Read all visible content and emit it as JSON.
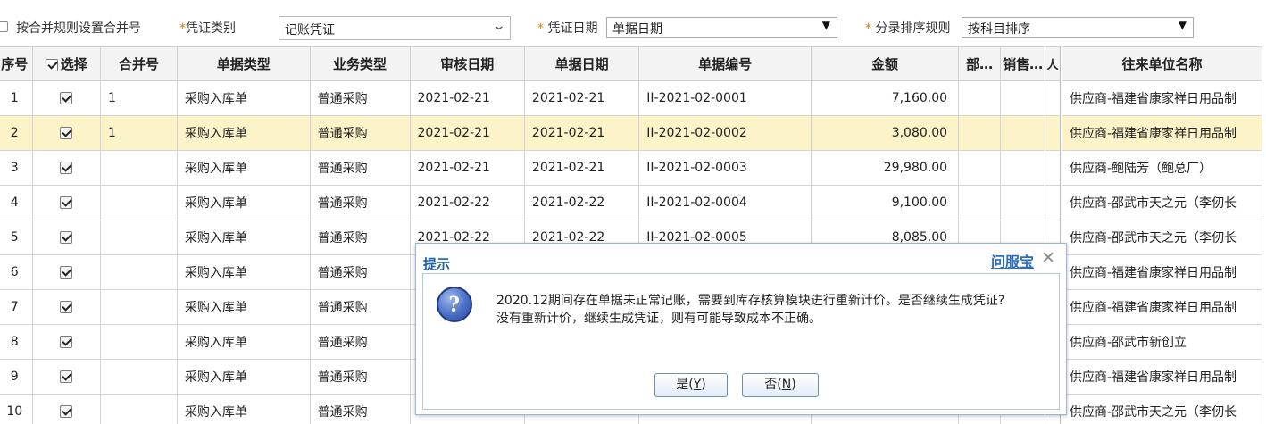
{
  "filter": {
    "merge_rule_label": "按合并规则设置合并号",
    "voucher_type_label": "凭证类别",
    "voucher_type_value": "记账凭证",
    "voucher_date_label": "凭证日期",
    "voucher_date_value": "单据日期",
    "sort_rule_label": "分录排序规则",
    "sort_rule_value": "按科目排序",
    "required_mark": "*"
  },
  "table": {
    "headers": [
      "序号",
      "选择",
      "合并号",
      "单据类型",
      "业务类型",
      "审核日期",
      "单据日期",
      "单据编号",
      "金额",
      "部…",
      "销售…",
      "人",
      "往来单位名称"
    ],
    "rows": [
      {
        "seq": "1",
        "merge": "1",
        "doc_type": "采购入库单",
        "biz_type": "普通采购",
        "audit_date": "2021-02-21",
        "doc_date": "2021-02-21",
        "doc_no": "II-2021-02-0001",
        "amount": "7,160.00",
        "party": "供应商-福建省康家祥日用品制"
      },
      {
        "seq": "2",
        "merge": "1",
        "doc_type": "采购入库单",
        "biz_type": "普通采购",
        "audit_date": "2021-02-21",
        "doc_date": "2021-02-21",
        "doc_no": "II-2021-02-0002",
        "amount": "3,080.00",
        "party": "供应商-福建省康家祥日用品制"
      },
      {
        "seq": "3",
        "merge": "",
        "doc_type": "采购入库单",
        "biz_type": "普通采购",
        "audit_date": "2021-02-21",
        "doc_date": "2021-02-21",
        "doc_no": "II-2021-02-0003",
        "amount": "29,980.00",
        "party": "供应商-鲍陆芳（鲍总厂）"
      },
      {
        "seq": "4",
        "merge": "",
        "doc_type": "采购入库单",
        "biz_type": "普通采购",
        "audit_date": "2021-02-22",
        "doc_date": "2021-02-22",
        "doc_no": "II-2021-02-0004",
        "amount": "9,100.00",
        "party": "供应商-邵武市天之元（李仞长"
      },
      {
        "seq": "5",
        "merge": "",
        "doc_type": "采购入库单",
        "biz_type": "普通采购",
        "audit_date": "2021-02-22",
        "doc_date": "2021-02-22",
        "doc_no": "II-2021-02-0005",
        "amount": "8,085.00",
        "party": "供应商-邵武市天之元（李仞长"
      },
      {
        "seq": "6",
        "merge": "",
        "doc_type": "采购入库单",
        "biz_type": "普通采购",
        "audit_date": "",
        "doc_date": "",
        "doc_no": "",
        "amount": "",
        "party": "供应商-福建省康家祥日用品制"
      },
      {
        "seq": "7",
        "merge": "",
        "doc_type": "采购入库单",
        "biz_type": "普通采购",
        "audit_date": "",
        "doc_date": "",
        "doc_no": "",
        "amount": "",
        "party": "供应商-福建省康家祥日用品制"
      },
      {
        "seq": "8",
        "merge": "",
        "doc_type": "采购入库单",
        "biz_type": "普通采购",
        "audit_date": "",
        "doc_date": "",
        "doc_no": "",
        "amount": "",
        "party": "供应商-邵武市新创立"
      },
      {
        "seq": "9",
        "merge": "",
        "doc_type": "采购入库单",
        "biz_type": "普通采购",
        "audit_date": "",
        "doc_date": "",
        "doc_no": "",
        "amount": "",
        "party": "供应商-福建省康家祥日用品制"
      },
      {
        "seq": "10",
        "merge": "",
        "doc_type": "采购入库单",
        "biz_type": "普通采购",
        "audit_date": "",
        "doc_date": "",
        "doc_no": "",
        "amount": "",
        "party": "供应商-邵武市天之元（李仞长"
      }
    ]
  },
  "dialog": {
    "title": "提示",
    "help_link": "问服宝",
    "close_glyph": "✕",
    "icon_glyph": "?",
    "message_line1": "2020.12期间存在单据未正常记账，需要到库存核算模块进行重新计价。是否继续生成凭证?",
    "message_line2": "没有重新计价，继续生成凭证，则有可能导致成本不正确。",
    "yes_label": "是(",
    "yes_key": "Y",
    "no_label": "否(",
    "no_key": "N",
    "close_paren": ")"
  },
  "icons": {
    "dropdown": "▼",
    "chevron": "⌄",
    "checkbox": "checkbox-checked-icon"
  },
  "colors": {
    "selected_row": "#fdf3c8",
    "required": "#e07b00",
    "dialog_title": "#1f5fa8"
  }
}
